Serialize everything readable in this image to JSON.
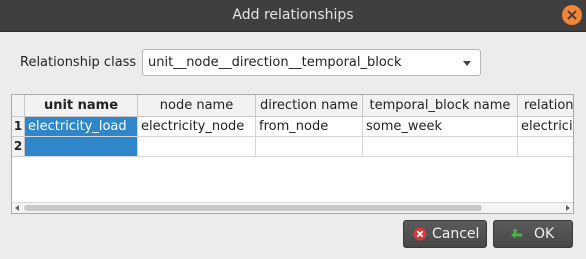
{
  "window": {
    "title": "Add relationships",
    "close_icon": "close-icon"
  },
  "relationship_class": {
    "label": "Relationship class",
    "value": "unit__node__direction__temporal_block"
  },
  "table": {
    "columns": [
      "unit name",
      "node name",
      "direction name",
      "temporal_block name",
      "relation"
    ],
    "rows": [
      {
        "num": "1",
        "cells": [
          "electricity_load",
          "electricity_node",
          "from_node",
          "some_week",
          "electrici"
        ]
      },
      {
        "num": "2",
        "cells": [
          "",
          "",
          "",
          "",
          ""
        ]
      }
    ]
  },
  "buttons": {
    "cancel": {
      "label": "Cancel",
      "icon": "cancel-icon"
    },
    "ok": {
      "label": "OK",
      "icon": "ok-icon"
    }
  },
  "colors": {
    "title_bar": "#3f3f3f",
    "close_button": "#f08437",
    "selection": "#2f86c9",
    "cancel_icon": "#d23b3b",
    "ok_icon": "#48b348"
  }
}
